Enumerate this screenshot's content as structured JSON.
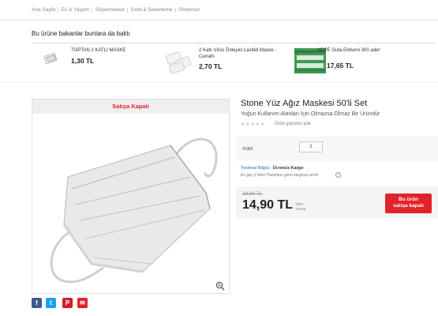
{
  "breadcrumb": [
    "Ana Sayfa",
    "Ev & Yaşam",
    "Süpermarket",
    "Gıda & Şekerleme",
    "Glutensiz"
  ],
  "related": {
    "title": "Bu ürüne bakanlar bunlara da baktı",
    "items": [
      {
        "name": "TOPTAN 2 KATLI MASKE",
        "price": "1,30 TL"
      },
      {
        "name": "2 Katlı Virüs Önleyici Lastikli Maske - Cerrahi",
        "price": "2,70 TL"
      },
      {
        "name": "HDPE Gıda Eldiveni 300 adet",
        "price": "17,65 TL"
      }
    ]
  },
  "product": {
    "status_banner": "Satışa Kapalı",
    "title": "Stone Yüz Ağız Maskesi 50'li Set",
    "subtitle": "Yoğun Kullanım Alanları İçin Olmazsa Olmaz Bir Üründür",
    "stars": "★★★★★",
    "review_text": "Ürün yorumu yok",
    "quantity_label": "Adet",
    "quantity_value": "1",
    "delivery_label": "Teslimat Bilgisi",
    "delivery_value": "Ücretsiz Kargo",
    "delivery_note": "En geç 2 Mart Pazartesi günü kargoya verilir",
    "old_price": "19,90 TL",
    "price": "14,90 TL",
    "kdv_line1": "KDV",
    "kdv_line2": "DAHİL",
    "buy_line1": "Bu ürün",
    "buy_line2": "satışa kapalı"
  },
  "social": [
    {
      "name": "facebook",
      "glyph": "f",
      "color": "#3b5998"
    },
    {
      "name": "twitter",
      "glyph": "t",
      "color": "#1da1f2"
    },
    {
      "name": "pinterest",
      "glyph": "P",
      "color": "#cb2027"
    },
    {
      "name": "email",
      "glyph": "✉",
      "color": "#e0232a"
    }
  ],
  "colors": {
    "accent_red": "#e0232a",
    "link_blue": "#2b66b5"
  }
}
